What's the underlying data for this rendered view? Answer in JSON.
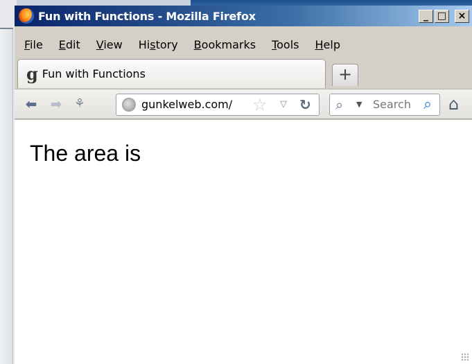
{
  "window": {
    "title": "Fun with Functions - Mozilla Firefox",
    "controls": {
      "minimize": "_",
      "maximize": "□",
      "close": "×"
    }
  },
  "menubar": {
    "items": [
      {
        "label": "File",
        "accel": "F",
        "rest": "ile"
      },
      {
        "label": "Edit",
        "accel": "E",
        "rest": "dit"
      },
      {
        "label": "View",
        "accel": "V",
        "rest": "iew"
      },
      {
        "label": "History",
        "accel": "H",
        "pre": "Hi",
        "accelMid": "s",
        "rest": "tory"
      },
      {
        "label": "Bookmarks",
        "accel": "B",
        "rest": "ookmarks"
      },
      {
        "label": "Tools",
        "accel": "T",
        "rest": "ools"
      },
      {
        "label": "Help",
        "accel": "H",
        "rest": "elp"
      }
    ]
  },
  "tabs": [
    {
      "favicon": "g",
      "label": "Fun with Functions"
    }
  ],
  "new_tab_label": "+",
  "navbar": {
    "back_icon": "back-arrow-icon",
    "forward_icon": "forward-arrow-icon",
    "url": "gunkelweb.com/",
    "search_placeholder": "Search"
  },
  "page": {
    "text": "The area is"
  },
  "colors": {
    "titlebar_start": "#0a246a",
    "titlebar_end": "#a6caf0",
    "chrome": "#d4d0c8",
    "content_bg": "#ffffff"
  }
}
